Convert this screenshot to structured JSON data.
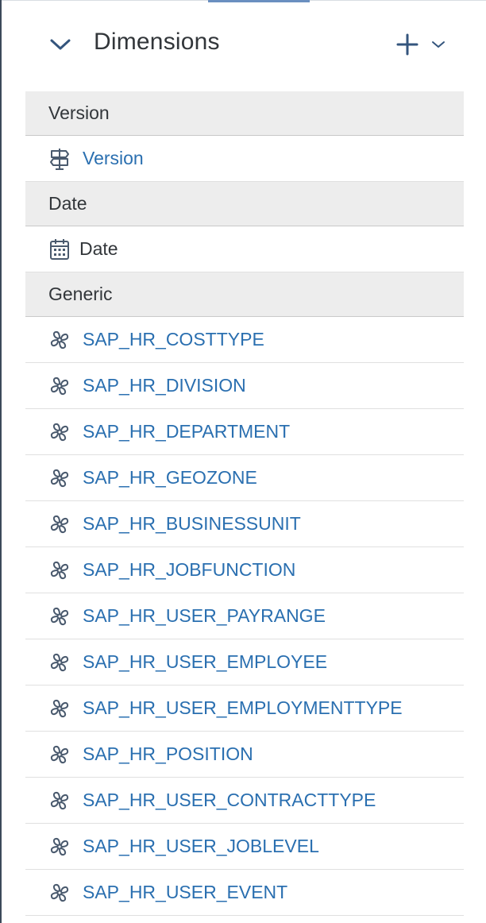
{
  "header": {
    "title": "Dimensions",
    "collapse_icon": "chevron-down-icon",
    "add_icon": "plus-icon",
    "add_menu_icon": "chevron-down-icon"
  },
  "colors": {
    "link": "#2a6fb0",
    "text": "#32363a",
    "group_background": "#ededed",
    "icon": "#4a5a6e"
  },
  "groups": [
    {
      "label": "Version",
      "items": [
        {
          "label": "Version",
          "icon": "signpost-icon"
        }
      ]
    },
    {
      "label": "Date",
      "items": [
        {
          "label": "Date",
          "icon": "calendar-icon"
        }
      ]
    },
    {
      "label": "Generic",
      "items": [
        {
          "label": "SAP_HR_COSTTYPE",
          "icon": "dimension-icon"
        },
        {
          "label": "SAP_HR_DIVISION",
          "icon": "dimension-icon"
        },
        {
          "label": "SAP_HR_DEPARTMENT",
          "icon": "dimension-icon"
        },
        {
          "label": "SAP_HR_GEOZONE",
          "icon": "dimension-icon"
        },
        {
          "label": "SAP_HR_BUSINESSUNIT",
          "icon": "dimension-icon"
        },
        {
          "label": "SAP_HR_JOBFUNCTION",
          "icon": "dimension-icon"
        },
        {
          "label": "SAP_HR_USER_PAYRANGE",
          "icon": "dimension-icon"
        },
        {
          "label": "SAP_HR_USER_EMPLOYEE",
          "icon": "dimension-icon"
        },
        {
          "label": "SAP_HR_USER_EMPLOYMENTTYPE",
          "icon": "dimension-icon"
        },
        {
          "label": "SAP_HR_POSITION",
          "icon": "dimension-icon"
        },
        {
          "label": "SAP_HR_USER_CONTRACTTYPE",
          "icon": "dimension-icon"
        },
        {
          "label": "SAP_HR_USER_JOBLEVEL",
          "icon": "dimension-icon"
        },
        {
          "label": "SAP_HR_USER_EVENT",
          "icon": "dimension-icon"
        }
      ]
    }
  ]
}
